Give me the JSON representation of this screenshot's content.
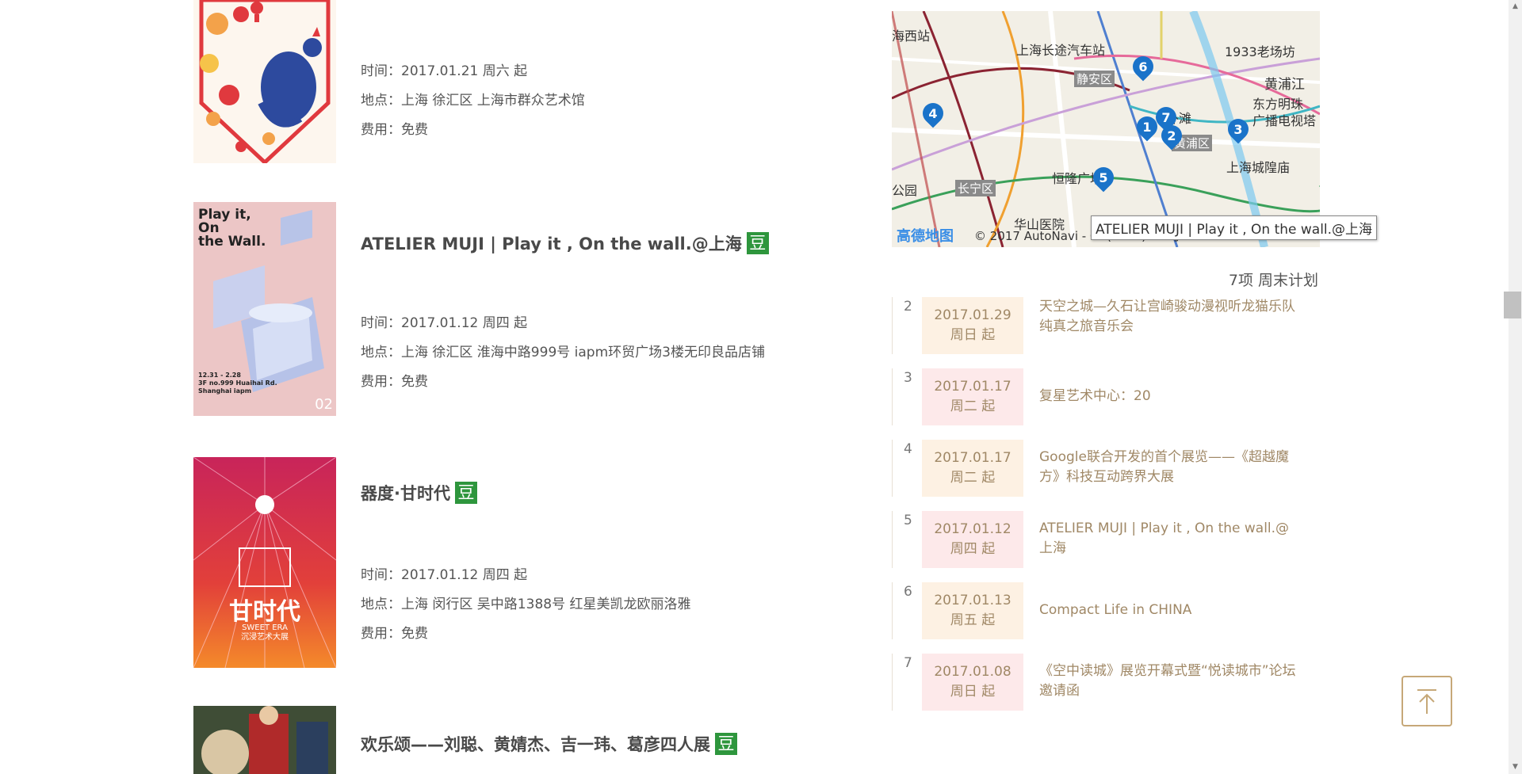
{
  "events": [
    {
      "title": "",
      "time": "时间：2017.01.21 周六 起",
      "location": "地点：上海 徐汇区 上海市群众艺术馆",
      "fee": "费用：免费"
    },
    {
      "title": "ATELIER MUJI | Play it , On the wall.@上海",
      "badge": "豆",
      "time": "时间：2017.01.12 周四 起",
      "location": "地点：上海 徐汇区 淮海中路999号 iapm环贸广场3楼无印良品店铺",
      "fee": "费用：免费",
      "poster_text": {
        "headline1": "Play it,",
        "headline2": "On",
        "headline3": "the Wall.",
        "dates": "12.31 - 2.28",
        "addr1": "3F no.999 Huaihai Rd.",
        "addr2": "Shanghai iapm",
        "num": "02"
      }
    },
    {
      "title": "器度·甘时代",
      "badge": "豆",
      "time": "时间：2017.01.12 周四 起",
      "location": "地点：上海 闵行区 吴中路1388号 红星美凯龙欧丽洛雅",
      "fee": "费用：免费",
      "poster_text": {
        "big": "甘时代",
        "sub1": "SWEET ERA",
        "sub2": "沉浸艺术大展"
      }
    },
    {
      "title": "欢乐颂——刘聪、黄婧杰、吉一玮、葛彦四人展",
      "badge": "豆"
    }
  ],
  "map": {
    "labels": {
      "haixizhan": "海西站",
      "changtu": "上海长途汽车站",
      "laochangfang": "1933老场坊",
      "jingan": "静安区",
      "huangpujiang": "黄浦江",
      "dongfang": "东方明珠",
      "guangbo": "广播电视塔",
      "waitan": "外滩",
      "huangpu": "黄浦区",
      "chenghuang": "上海城隍庙",
      "henglong": "恒隆广场",
      "gongyuan": "公园",
      "changning": "长宁区",
      "huashan": "华山医院"
    },
    "pins": [
      "1",
      "2",
      "3",
      "4",
      "5",
      "6",
      "7"
    ],
    "logo": "高德地图",
    "copyright": "© 2017 AutoNavi - GS(2016)710号",
    "tooltip": "ATELIER MUJI | Play it , On the wall.@上海"
  },
  "plan": {
    "header": "7项 周末计划",
    "items": [
      {
        "num": "2",
        "date": "2017.01.29",
        "weekday": "周日 起",
        "title": "天空之城—久石让宫崎骏动漫视听龙猫乐队纯真之旅音乐会"
      },
      {
        "num": "3",
        "date": "2017.01.17",
        "weekday": "周二 起",
        "title": "复星艺术中心：20"
      },
      {
        "num": "4",
        "date": "2017.01.17",
        "weekday": "周二 起",
        "title": "Google联合开发的首个展览——《超越魔方》科技互动跨界大展"
      },
      {
        "num": "5",
        "date": "2017.01.12",
        "weekday": "周四 起",
        "title": "ATELIER MUJI | Play it , On the wall.@上海"
      },
      {
        "num": "6",
        "date": "2017.01.13",
        "weekday": "周五 起",
        "title": "Compact Life in CHINA"
      },
      {
        "num": "7",
        "date": "2017.01.08",
        "weekday": "周日 起",
        "title": "《空中读城》展览开幕式暨“悦读城市”论坛邀请函"
      }
    ]
  },
  "colors": {
    "accent": "#a08866",
    "badge": "#2e963d",
    "pin": "#1a73c9",
    "date_peach": "#fdf1e3",
    "date_pink": "#fde9ea"
  },
  "icons": {
    "back_to_top": "arrow-up-to-line-icon"
  }
}
